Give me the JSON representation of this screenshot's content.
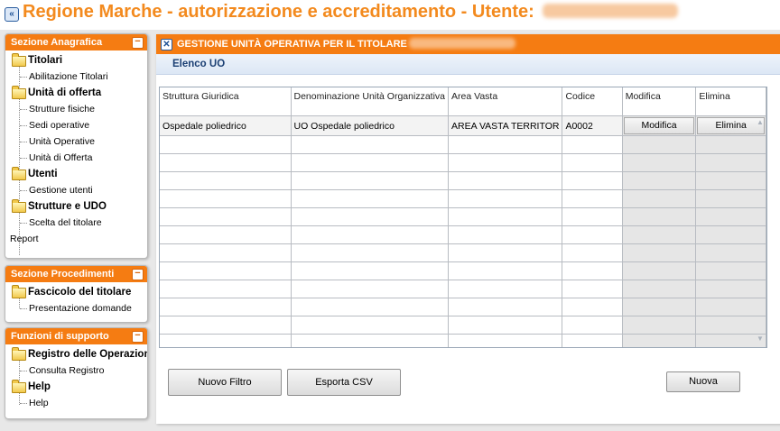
{
  "header": {
    "title": "Regione Marche - autorizzazione e accreditamento - Utente:",
    "collapse_icon": "double-chevron-left-icon"
  },
  "sidebar": {
    "panels": [
      {
        "title": "Sezione Anagrafica",
        "items": [
          {
            "label": "Titolari",
            "type": "category"
          },
          {
            "label": "Abilitazione Titolari",
            "type": "leaf"
          },
          {
            "label": "Unità di offerta",
            "type": "category"
          },
          {
            "label": "Strutture fisiche",
            "type": "leaf"
          },
          {
            "label": "Sedi operative",
            "type": "leaf"
          },
          {
            "label": "Unità Operative",
            "type": "leaf"
          },
          {
            "label": "Unità di Offerta",
            "type": "leaf"
          },
          {
            "label": "Utenti",
            "type": "category"
          },
          {
            "label": "Gestione utenti",
            "type": "leaf"
          },
          {
            "label": "Strutture e UDO",
            "type": "category"
          },
          {
            "label": "Scelta del titolare",
            "type": "leaf"
          },
          {
            "label": "Report",
            "type": "root"
          }
        ]
      },
      {
        "title": "Sezione Procedimenti",
        "items": [
          {
            "label": "Fascicolo del titolare",
            "type": "category"
          },
          {
            "label": "Presentazione domande",
            "type": "leaf"
          }
        ]
      },
      {
        "title": "Funzioni di supporto",
        "items": [
          {
            "label": "Registro delle Operazioni",
            "type": "category"
          },
          {
            "label": "Consulta Registro",
            "type": "leaf"
          },
          {
            "label": "Help",
            "type": "category"
          },
          {
            "label": "Help",
            "type": "leaf"
          }
        ]
      }
    ]
  },
  "main": {
    "title": "GESTIONE UNITÀ OPERATIVA PER IL TITOLARE",
    "section": "Elenco UO",
    "table": {
      "columns": [
        "Struttura Giuridica",
        "Denominazione Unità Organizzativa",
        "Area Vasta",
        "Codice",
        "Modifica",
        "Elimina"
      ],
      "rows": [
        {
          "struttura": "Ospedale poliedrico",
          "denominazione": "UO Ospedale poliedrico",
          "area": "AREA VASTA TERRITOR",
          "codice": "A0002",
          "modifica": "Modifica",
          "elimina": "Elimina"
        }
      ]
    },
    "buttons": {
      "nuovo_filtro": "Nuovo Filtro",
      "esporta_csv": "Esporta CSV",
      "nuova": "Nuova"
    }
  },
  "colors": {
    "accent": "#f57c12",
    "title": "#f38a1e"
  }
}
